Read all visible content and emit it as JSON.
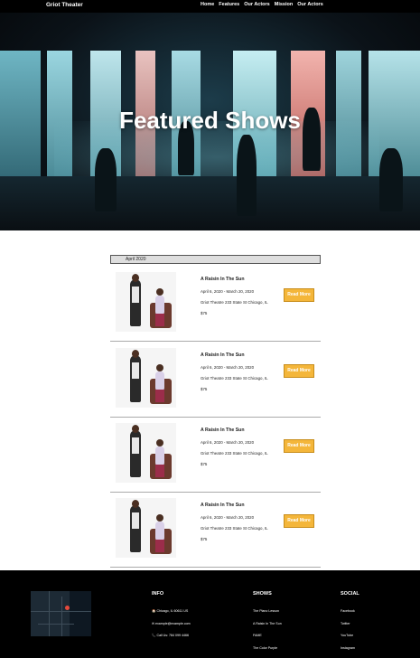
{
  "header": {
    "brand": "Griot Theater",
    "nav": [
      "Home",
      "Features",
      "Our Actors",
      "Mission",
      "Our Actors"
    ]
  },
  "hero": {
    "title": "Featured Shows"
  },
  "month": "April 2020",
  "shows": [
    {
      "title": "A Raisin In The Sun",
      "dates": "April 6, 2020 - March 20, 2020",
      "venue": "Griot Theatre 233 State St Chicago, IL",
      "price": "$75",
      "button": "Read More"
    },
    {
      "title": "A Raisin In The Sun",
      "dates": "April 6, 2020 - March 20, 2020",
      "venue": "Griot Theatre 233 State St Chicago, IL",
      "price": "$75",
      "button": "Read More"
    },
    {
      "title": "A Raisin In The Sun",
      "dates": "April 6, 2020 - March 20, 2020",
      "venue": "Griot Theatre 233 State St Chicago, IL",
      "price": "$75",
      "button": "Read More"
    },
    {
      "title": "A Raisin In The Sun",
      "dates": "April 6, 2020 - March 20, 2020",
      "venue": "Griot Theatre 233 State St Chicago, IL",
      "price": "$75",
      "button": "Read More"
    }
  ],
  "footer": {
    "info": {
      "heading": "INFO",
      "address": "🏠 Chicago, IL 60611 US",
      "email": "✉ example@example.com",
      "phone": "📞 Call Us: 784 099 4466"
    },
    "shows": {
      "heading": "SHOWS",
      "items": [
        "The Piano Lesson",
        "A Raisin In The Sun",
        "FAME",
        "The Color Purple"
      ]
    },
    "social": {
      "heading": "SOCIAL",
      "items": [
        "Facebook",
        "Twitter",
        "YouTube",
        "Instagram"
      ]
    }
  },
  "colors": {
    "accent": "#f4b63a",
    "header_bg": "#000000",
    "footer_bg": "#000000"
  },
  "icons": {
    "home": "home-icon",
    "email": "email-icon",
    "phone": "phone-icon"
  }
}
